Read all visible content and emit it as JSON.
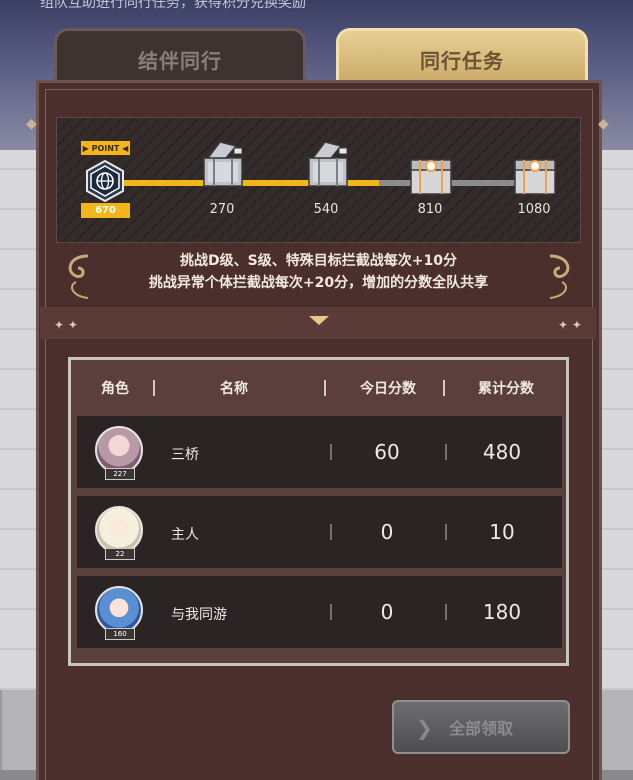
{
  "header": {
    "top_text": "组队互助进行同行任务，获得积分兑换奖励"
  },
  "tabs": [
    {
      "label": "结伴同行",
      "active": false
    },
    {
      "label": "同行任务",
      "active": true
    }
  ],
  "progress": {
    "point_tag": "▶ POINT ◀",
    "current_points": "670",
    "current_fraction": 0.83,
    "milestones": [
      "270",
      "540",
      "810",
      "1080"
    ],
    "milestone_state": [
      "opened",
      "opened",
      "locked",
      "locked"
    ]
  },
  "notice": {
    "line1": "挑战D级、S级、特殊目标拦截战每次+10分",
    "line2": "挑战异常个体拦截战每次+20分，增加的分数全队共享"
  },
  "table": {
    "headers": [
      "角色",
      "名称",
      "今日分数",
      "累计分数"
    ],
    "rows": [
      {
        "level": "227",
        "name": "三桥",
        "today": "60",
        "total": "480"
      },
      {
        "level": "22",
        "name": "主人",
        "today": "0",
        "total": "10"
      },
      {
        "level": "160",
        "name": "与我同游",
        "today": "0",
        "total": "180"
      }
    ]
  },
  "claim_button": {
    "label": "全部领取",
    "enabled": false
  },
  "colors": {
    "accent_gold": "#f2b51a",
    "panel": "#4b2f2d",
    "row_bg": "#2a2424"
  }
}
